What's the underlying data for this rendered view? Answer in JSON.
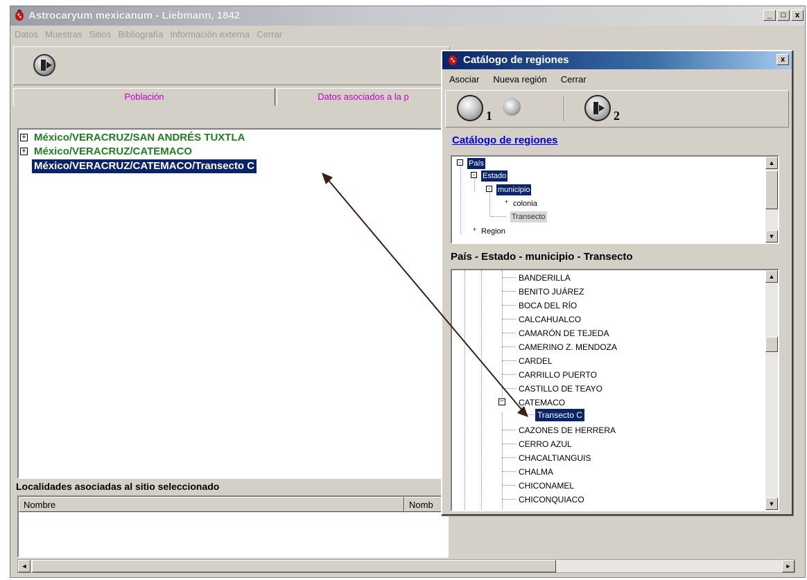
{
  "main_window": {
    "title": "Astrocaryum mexicanum - Liebmann, 1842",
    "window_buttons": [
      "_",
      "□",
      "x"
    ],
    "menu": [
      "Datos",
      "Muestras",
      "Sitios",
      "Bibliografía",
      "Información externa",
      "Cerrar"
    ],
    "toolbar_icon": "exit-door-icon",
    "tabs": [
      "Población",
      "Datos asociados a la p"
    ],
    "tree": {
      "rows": [
        {
          "label": "México/VERACRUZ/SAN ANDRÉS TUXTLA",
          "expander": "+"
        },
        {
          "label": "México/VERACRUZ/CATEMACO",
          "expander": "+"
        },
        {
          "label": "México/VERACRUZ/CATEMACO/Transecto C",
          "expander": ""
        }
      ],
      "selected_index": 2
    },
    "localidades_label": "Localidades asociadas al sitio seleccionado",
    "list_columns": [
      "Nombre",
      "Nomb"
    ]
  },
  "dialog": {
    "title": "Catálogo de regiones",
    "close": "x",
    "menu": [
      "Asociar",
      "Nueva región",
      "Cerrar"
    ],
    "toolbar": {
      "num1": "1",
      "num2": "2",
      "icons": [
        "region-tool-icon",
        "globe-icon",
        "exit-door-icon"
      ]
    },
    "catalog_link": "Catálogo de regiones",
    "hierarchy": [
      {
        "label": "País",
        "expander": "-",
        "selected": true
      },
      {
        "label": "Estado",
        "expander": "-",
        "selected": true
      },
      {
        "label": "municipio",
        "expander": "-",
        "selected": true
      },
      {
        "label": "colonia",
        "expander": "+"
      },
      {
        "label": "Transecto",
        "greyed": true
      },
      {
        "label": "Region",
        "expander": "+"
      }
    ],
    "path_label": "País - Estado - municipio - Transecto",
    "municipios": [
      "BANDERILLA",
      "BENITO JUÁREZ",
      "BOCA DEL RÍO",
      "CALCAHUALCO",
      "CAMARÓN DE TEJEDA",
      "CAMERINO Z. MENDOZA",
      "CARDEL",
      "CARRILLO PUERTO",
      "CASTILLO DE TEAYO",
      "CATEMACO",
      "Transecto C",
      "CAZONES DE HERRERA",
      "CERRO AZUL",
      "CHACALTIANGUIS",
      "CHALMA",
      "CHICONAMEL",
      "CHICONQUIACO"
    ]
  },
  "colors": {
    "selection": "#0a246a",
    "tree_text": "#1e7f1e",
    "tab_text": "#c000c0",
    "link": "#0000e0",
    "arrow": "#3a1f12"
  }
}
